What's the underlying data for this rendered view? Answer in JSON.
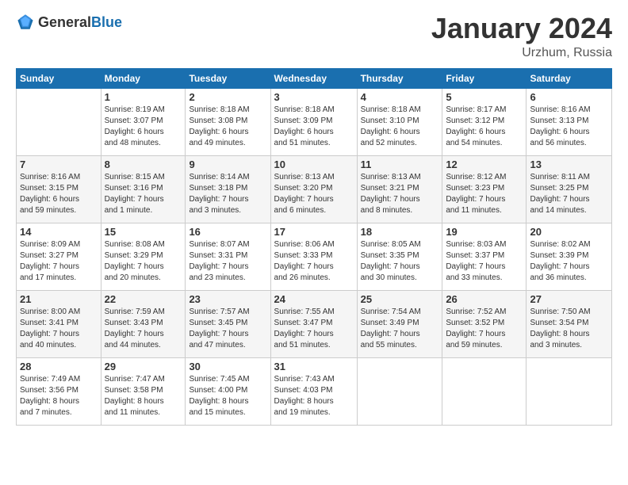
{
  "header": {
    "logo_general": "General",
    "logo_blue": "Blue",
    "title": "January 2024",
    "location": "Urzhum, Russia"
  },
  "calendar": {
    "days_of_week": [
      "Sunday",
      "Monday",
      "Tuesday",
      "Wednesday",
      "Thursday",
      "Friday",
      "Saturday"
    ],
    "weeks": [
      [
        {
          "day": "",
          "info": ""
        },
        {
          "day": "1",
          "info": "Sunrise: 8:19 AM\nSunset: 3:07 PM\nDaylight: 6 hours\nand 48 minutes."
        },
        {
          "day": "2",
          "info": "Sunrise: 8:18 AM\nSunset: 3:08 PM\nDaylight: 6 hours\nand 49 minutes."
        },
        {
          "day": "3",
          "info": "Sunrise: 8:18 AM\nSunset: 3:09 PM\nDaylight: 6 hours\nand 51 minutes."
        },
        {
          "day": "4",
          "info": "Sunrise: 8:18 AM\nSunset: 3:10 PM\nDaylight: 6 hours\nand 52 minutes."
        },
        {
          "day": "5",
          "info": "Sunrise: 8:17 AM\nSunset: 3:12 PM\nDaylight: 6 hours\nand 54 minutes."
        },
        {
          "day": "6",
          "info": "Sunrise: 8:16 AM\nSunset: 3:13 PM\nDaylight: 6 hours\nand 56 minutes."
        }
      ],
      [
        {
          "day": "7",
          "info": "Sunrise: 8:16 AM\nSunset: 3:15 PM\nDaylight: 6 hours\nand 59 minutes."
        },
        {
          "day": "8",
          "info": "Sunrise: 8:15 AM\nSunset: 3:16 PM\nDaylight: 7 hours\nand 1 minute."
        },
        {
          "day": "9",
          "info": "Sunrise: 8:14 AM\nSunset: 3:18 PM\nDaylight: 7 hours\nand 3 minutes."
        },
        {
          "day": "10",
          "info": "Sunrise: 8:13 AM\nSunset: 3:20 PM\nDaylight: 7 hours\nand 6 minutes."
        },
        {
          "day": "11",
          "info": "Sunrise: 8:13 AM\nSunset: 3:21 PM\nDaylight: 7 hours\nand 8 minutes."
        },
        {
          "day": "12",
          "info": "Sunrise: 8:12 AM\nSunset: 3:23 PM\nDaylight: 7 hours\nand 11 minutes."
        },
        {
          "day": "13",
          "info": "Sunrise: 8:11 AM\nSunset: 3:25 PM\nDaylight: 7 hours\nand 14 minutes."
        }
      ],
      [
        {
          "day": "14",
          "info": "Sunrise: 8:09 AM\nSunset: 3:27 PM\nDaylight: 7 hours\nand 17 minutes."
        },
        {
          "day": "15",
          "info": "Sunrise: 8:08 AM\nSunset: 3:29 PM\nDaylight: 7 hours\nand 20 minutes."
        },
        {
          "day": "16",
          "info": "Sunrise: 8:07 AM\nSunset: 3:31 PM\nDaylight: 7 hours\nand 23 minutes."
        },
        {
          "day": "17",
          "info": "Sunrise: 8:06 AM\nSunset: 3:33 PM\nDaylight: 7 hours\nand 26 minutes."
        },
        {
          "day": "18",
          "info": "Sunrise: 8:05 AM\nSunset: 3:35 PM\nDaylight: 7 hours\nand 30 minutes."
        },
        {
          "day": "19",
          "info": "Sunrise: 8:03 AM\nSunset: 3:37 PM\nDaylight: 7 hours\nand 33 minutes."
        },
        {
          "day": "20",
          "info": "Sunrise: 8:02 AM\nSunset: 3:39 PM\nDaylight: 7 hours\nand 36 minutes."
        }
      ],
      [
        {
          "day": "21",
          "info": "Sunrise: 8:00 AM\nSunset: 3:41 PM\nDaylight: 7 hours\nand 40 minutes."
        },
        {
          "day": "22",
          "info": "Sunrise: 7:59 AM\nSunset: 3:43 PM\nDaylight: 7 hours\nand 44 minutes."
        },
        {
          "day": "23",
          "info": "Sunrise: 7:57 AM\nSunset: 3:45 PM\nDaylight: 7 hours\nand 47 minutes."
        },
        {
          "day": "24",
          "info": "Sunrise: 7:55 AM\nSunset: 3:47 PM\nDaylight: 7 hours\nand 51 minutes."
        },
        {
          "day": "25",
          "info": "Sunrise: 7:54 AM\nSunset: 3:49 PM\nDaylight: 7 hours\nand 55 minutes."
        },
        {
          "day": "26",
          "info": "Sunrise: 7:52 AM\nSunset: 3:52 PM\nDaylight: 7 hours\nand 59 minutes."
        },
        {
          "day": "27",
          "info": "Sunrise: 7:50 AM\nSunset: 3:54 PM\nDaylight: 8 hours\nand 3 minutes."
        }
      ],
      [
        {
          "day": "28",
          "info": "Sunrise: 7:49 AM\nSunset: 3:56 PM\nDaylight: 8 hours\nand 7 minutes."
        },
        {
          "day": "29",
          "info": "Sunrise: 7:47 AM\nSunset: 3:58 PM\nDaylight: 8 hours\nand 11 minutes."
        },
        {
          "day": "30",
          "info": "Sunrise: 7:45 AM\nSunset: 4:00 PM\nDaylight: 8 hours\nand 15 minutes."
        },
        {
          "day": "31",
          "info": "Sunrise: 7:43 AM\nSunset: 4:03 PM\nDaylight: 8 hours\nand 19 minutes."
        },
        {
          "day": "",
          "info": ""
        },
        {
          "day": "",
          "info": ""
        },
        {
          "day": "",
          "info": ""
        }
      ]
    ]
  }
}
